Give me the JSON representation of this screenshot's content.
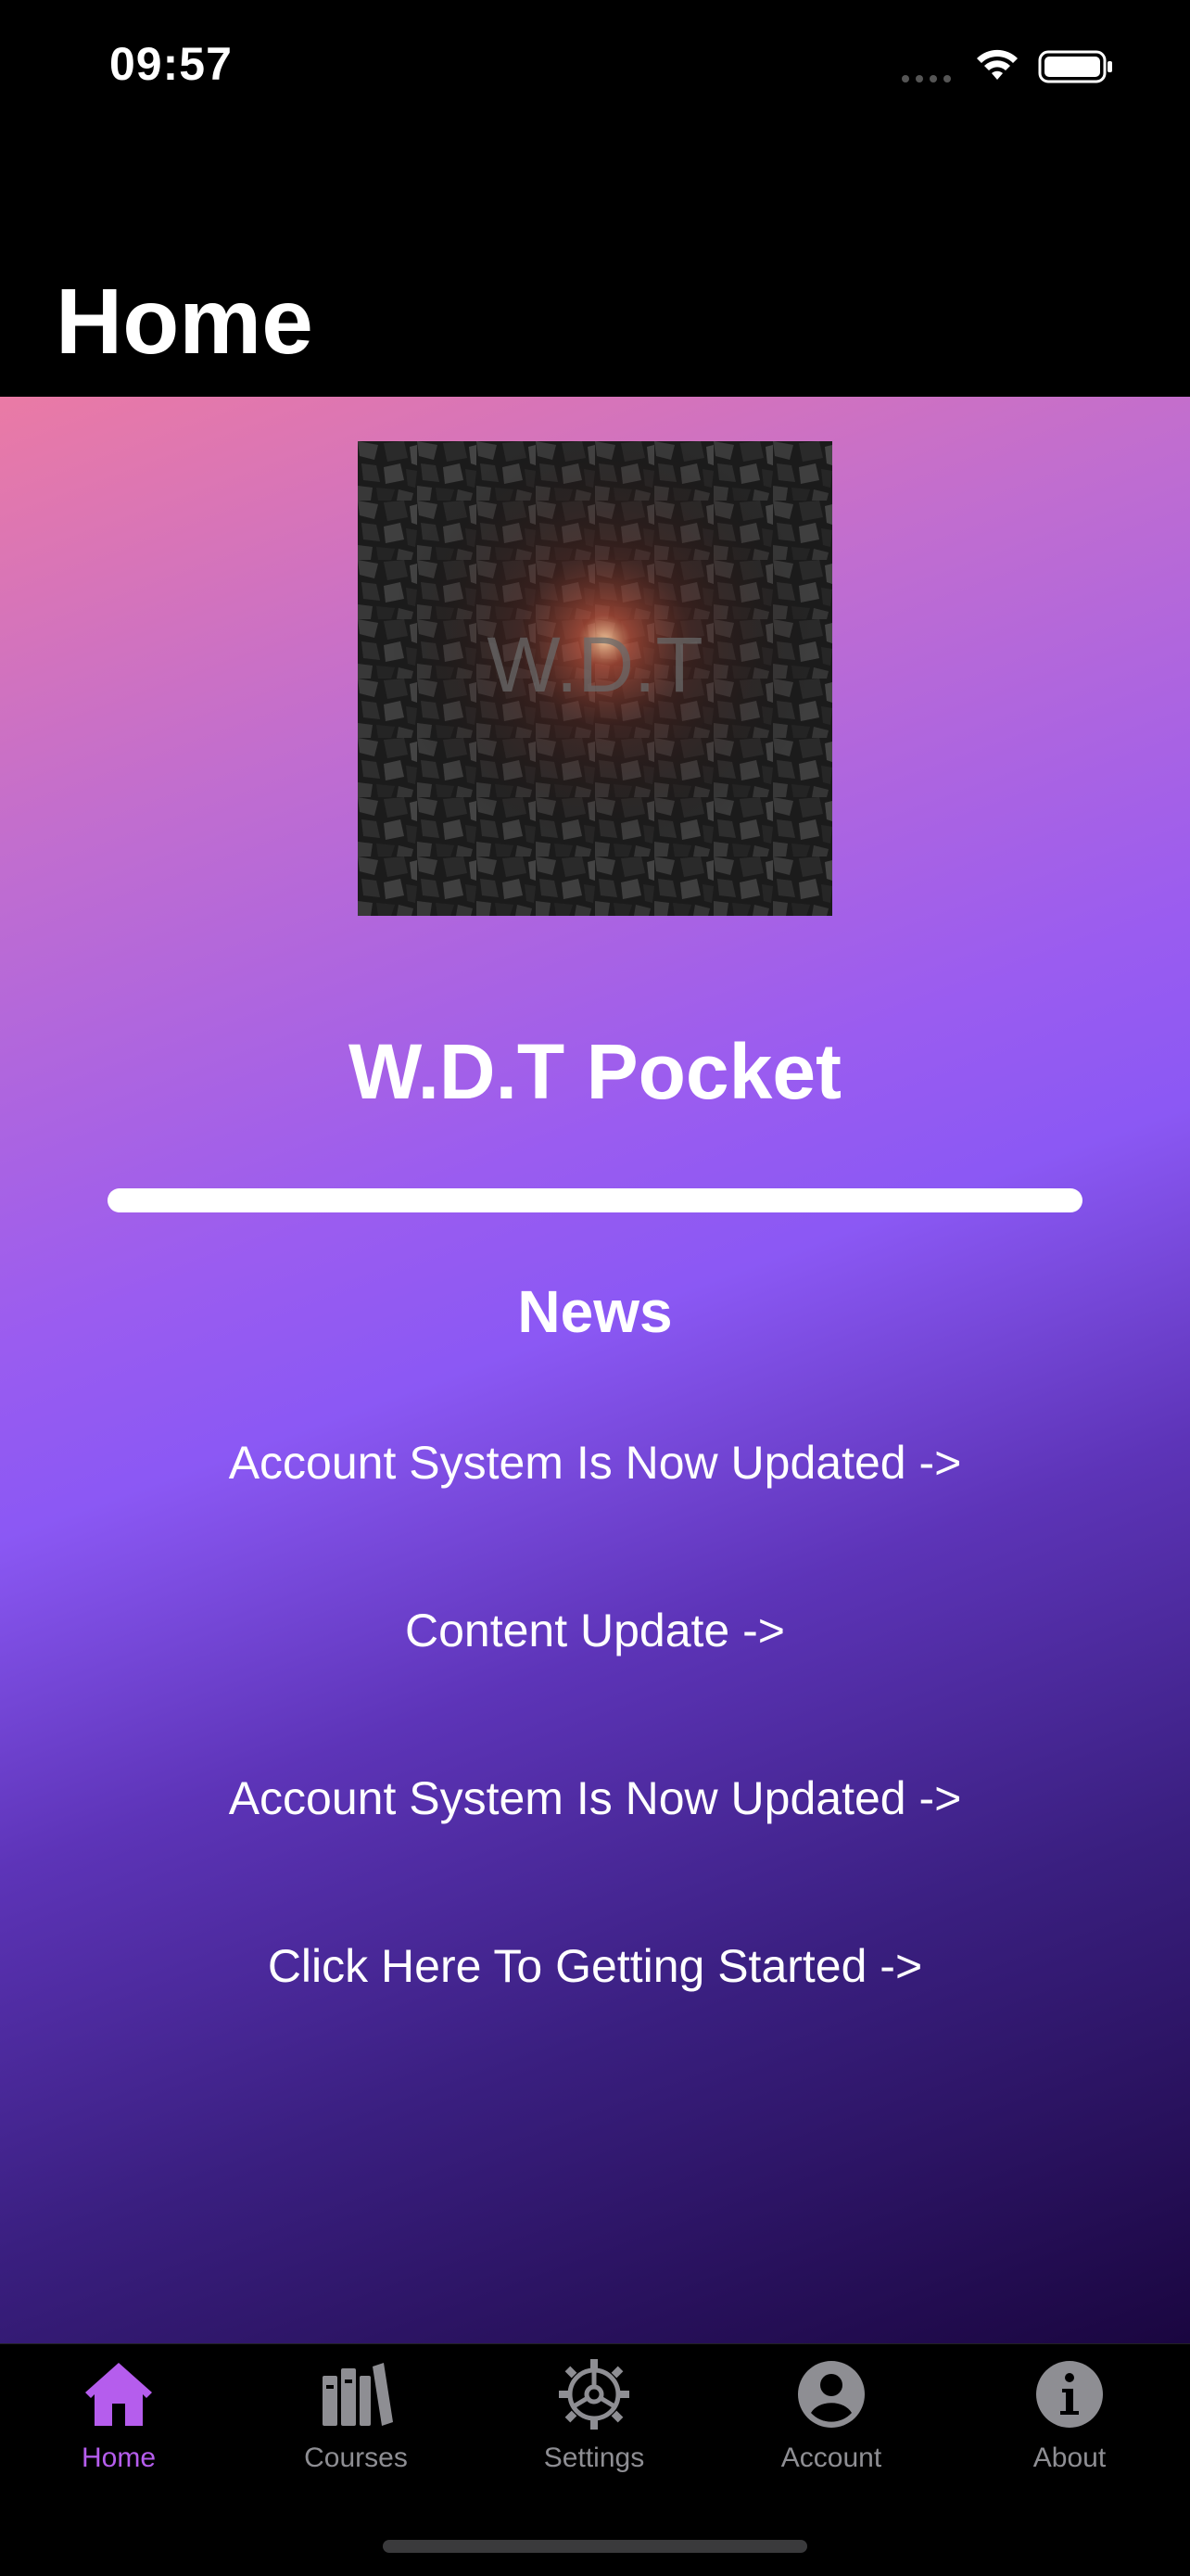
{
  "status_bar": {
    "time": "09:57"
  },
  "nav": {
    "title": "Home"
  },
  "main": {
    "logo_text": "W.D.T",
    "app_name": "W.D.T Pocket",
    "news_heading": "News",
    "news_items": [
      "Account System Is Now Updated ->",
      "Content Update ->",
      "Account System Is Now Updated ->",
      "Click Here To Getting Started ->"
    ]
  },
  "tab_bar": {
    "tabs": [
      {
        "label": "Home",
        "icon": "house-icon",
        "active": true
      },
      {
        "label": "Courses",
        "icon": "books-icon",
        "active": false
      },
      {
        "label": "Settings",
        "icon": "gear-icon",
        "active": false
      },
      {
        "label": "Account",
        "icon": "person-circle-icon",
        "active": false
      },
      {
        "label": "About",
        "icon": "info-circle-icon",
        "active": false
      }
    ]
  },
  "colors": {
    "accent": "#b55ded",
    "inactive": "#8e8e93",
    "gradient_top": "#ea7aa5",
    "gradient_mid": "#8b58f4",
    "gradient_bottom": "#1a0640"
  }
}
